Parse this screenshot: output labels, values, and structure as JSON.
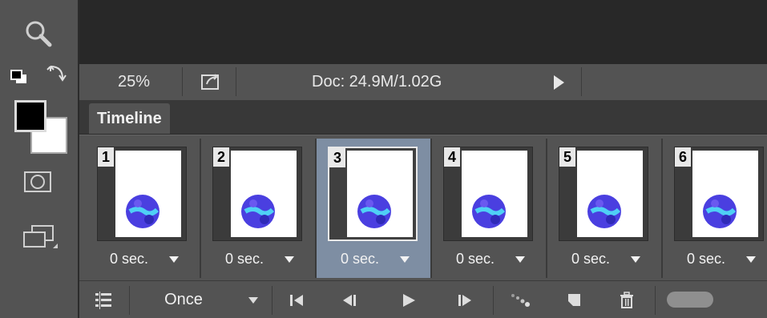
{
  "status_bar": {
    "zoom": "25%",
    "doc_info": "Doc: 24.9M/1.02G"
  },
  "panel": {
    "tab_label": "Timeline"
  },
  "frames": [
    {
      "number": "1",
      "delay": "0 sec.",
      "selected": false
    },
    {
      "number": "2",
      "delay": "0 sec.",
      "selected": false
    },
    {
      "number": "3",
      "delay": "0 sec.",
      "selected": true
    },
    {
      "number": "4",
      "delay": "0 sec.",
      "selected": false
    },
    {
      "number": "5",
      "delay": "0 sec.",
      "selected": false
    },
    {
      "number": "6",
      "delay": "0 sec.",
      "selected": false
    }
  ],
  "controls": {
    "loop_option": "Once",
    "icons": [
      "convert-timeline-icon",
      "first-frame-icon",
      "previous-frame-icon",
      "play-icon",
      "next-frame-icon",
      "tween-icon",
      "duplicate-frame-icon",
      "delete-frame-icon"
    ]
  },
  "colors": {
    "foreground": "#000000",
    "background": "#ffffff",
    "selection": "#7e8ea3",
    "panel": "#535353"
  }
}
